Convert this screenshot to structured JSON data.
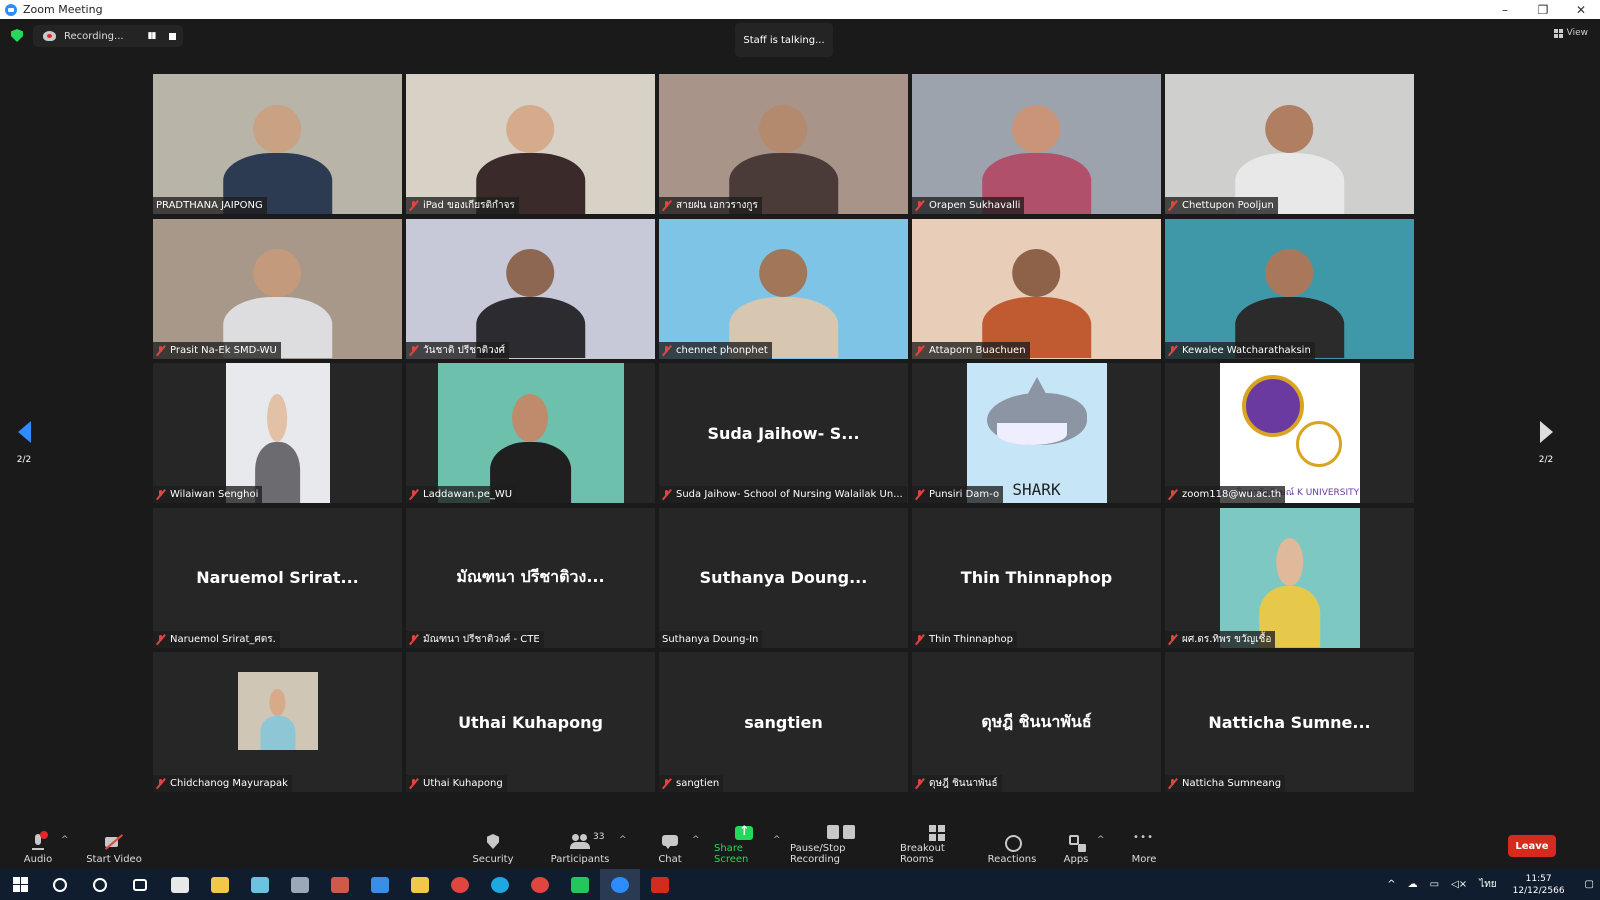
{
  "window": {
    "title": "Zoom Meeting",
    "controls": [
      "–",
      "❐",
      "✕"
    ]
  },
  "topbar": {
    "recording_label": "Recording...",
    "pause_glyph": "▮▮",
    "talking": "Staff is talking...",
    "view_label": "View"
  },
  "pager": {
    "left": "2/2",
    "right": "2/2"
  },
  "tiles": [
    {
      "label": "PRADTHANA JAIPONG",
      "muted": false,
      "video": "full",
      "bg": "#b9b4a8",
      "skin": "#c9a183",
      "shirt": "#2c3b52"
    },
    {
      "label": "iPad ของเกียรติกำจร",
      "muted": true,
      "video": "full",
      "bg": "#d8d2c6",
      "skin": "#d6ab8c",
      "shirt": "#3a2a2a"
    },
    {
      "label": "สายฝน เอกวรางกูร",
      "muted": true,
      "video": "full",
      "bg": "#a89489",
      "skin": "#b48a6e",
      "shirt": "#4a3a38"
    },
    {
      "label": "Orapen Sukhavalli",
      "muted": true,
      "video": "full",
      "bg": "#9da3ad",
      "skin": "#c99478",
      "shirt": "#b0506a"
    },
    {
      "label": "Chettupon Pooljun",
      "muted": true,
      "video": "full",
      "bg": "#cfd0ce",
      "skin": "#b07f62",
      "shirt": "#e8e8e8"
    },
    {
      "label": "Prasit Na-Ek SMD-WU",
      "muted": true,
      "video": "full",
      "bg": "#a7988a",
      "skin": "#c39a7c",
      "shirt": "#dddde0"
    },
    {
      "label": "วันชาติ ปรีชาติวงศ์",
      "muted": true,
      "video": "full",
      "bg": "#c7c9d9",
      "skin": "#8d6751",
      "shirt": "#2b2b30"
    },
    {
      "label": "chennet phonphet",
      "muted": true,
      "video": "full",
      "bg": "#7ec4e6",
      "skin": "#a27659",
      "shirt": "#d8c7b0"
    },
    {
      "label": "Attaporn Buachuen",
      "muted": true,
      "video": "full",
      "bg": "#e8cdb8",
      "skin": "#8e6248",
      "shirt": "#c05a30"
    },
    {
      "label": "Kewalee Watcharathaksin",
      "muted": true,
      "video": "full",
      "bg": "#3f98a8",
      "skin": "#a9785b",
      "shirt": "#2b2b2b"
    },
    {
      "label": "Wilaiwan Senghoi",
      "muted": true,
      "video": "narrow",
      "bg": "#e7e9ec",
      "skin": "#e2c1a6",
      "shirt": "#6b6b70"
    },
    {
      "label": "Laddawan.pe_WU",
      "muted": true,
      "video": "mid",
      "bg": "#6cc0ac",
      "skin": "#c08a6c",
      "shirt": "#1f1f1f"
    },
    {
      "label": "Suda  Jaihow-  School of Nursing  Walailak Un...",
      "muted": true,
      "video": "none",
      "bigname": "Suda  Jaihow-  S..."
    },
    {
      "label": "Punsiri Dam-o",
      "muted": true,
      "video": "shark",
      "bg": "#c6e6f7",
      "art_text": "SHARK"
    },
    {
      "label": "zoom118@wu.ac.th",
      "muted": true,
      "video": "seal",
      "bg": "#ffffff",
      "art_text": "มหาวิทยาลัยลักษณ์  K UNIVERSITY"
    },
    {
      "label": "Naruemol Srirat_ศตร.",
      "muted": true,
      "video": "none",
      "bigname": "Naruemol  Srirat..."
    },
    {
      "label": "มัณฑนา ปรีชาติวงศ์ - CTE",
      "muted": true,
      "video": "none",
      "bigname": "มัณฑนา ปรีชาติวง..."
    },
    {
      "label": "Suthanya Doung-In",
      "muted": false,
      "video": "none",
      "bigname": "Suthanya  Doung..."
    },
    {
      "label": "Thin Thinnaphop",
      "muted": true,
      "video": "none",
      "bigname": "Thin Thinnaphop"
    },
    {
      "label": "ผศ.ดร.ทิพร ขวัญเชื้อ",
      "muted": true,
      "video": "sq",
      "bg": "#7ec8c4",
      "skin": "#e0b89a",
      "shirt": "#e6c94a"
    },
    {
      "label": "Chidchanog Mayurapak",
      "muted": true,
      "video": "small",
      "bg": "#cfc6b6",
      "skin": "#d8aa8a",
      "shirt": "#8fc6d6"
    },
    {
      "label": "Uthai Kuhapong",
      "muted": true,
      "video": "none",
      "bigname": "Uthai Kuhapong"
    },
    {
      "label": "sangtien",
      "muted": true,
      "video": "none",
      "bigname": "sangtien"
    },
    {
      "label": "ดุษฎี ชินนาพันธ์",
      "muted": true,
      "video": "none",
      "bigname": "ดุษฎี ชินนาพันธ์"
    },
    {
      "label": "Natticha Sumneang",
      "muted": true,
      "video": "none",
      "bigname": "Natticha  Sumne..."
    }
  ],
  "toolbar": {
    "audio": "Audio",
    "start_video": "Start Video",
    "security": "Security",
    "participants": "Participants",
    "participants_count": "33",
    "chat": "Chat",
    "share_screen": "Share Screen",
    "record": "Pause/Stop Recording",
    "breakout": "Breakout Rooms",
    "reactions": "Reactions",
    "apps": "Apps",
    "more": "More",
    "leave": "Leave",
    "caret": "^"
  },
  "taskbar": {
    "apps": [
      "start",
      "search",
      "cortana",
      "task-view",
      "mail",
      "store",
      "notes",
      "pen",
      "paint",
      "ie",
      "explorer",
      "chrome",
      "edge",
      "chrome-2",
      "line",
      "zoom",
      "acrobat"
    ],
    "app_colors": [
      "#ffffff",
      "#ffffff",
      "#ffffff",
      "#ffffff",
      "#e8e8e8",
      "#f2c84b",
      "#6cc3e0",
      "#9aa8b8",
      "#d05a4a",
      "#3a8ee6",
      "#f2c84b",
      "#e0453f",
      "#1fa7e0",
      "#e0453f",
      "#23c75a",
      "#2d8cff",
      "#d52b1e"
    ],
    "tray_caret": "^",
    "lang": "ไทย",
    "time": "11:57",
    "date": "12/12/2566"
  }
}
